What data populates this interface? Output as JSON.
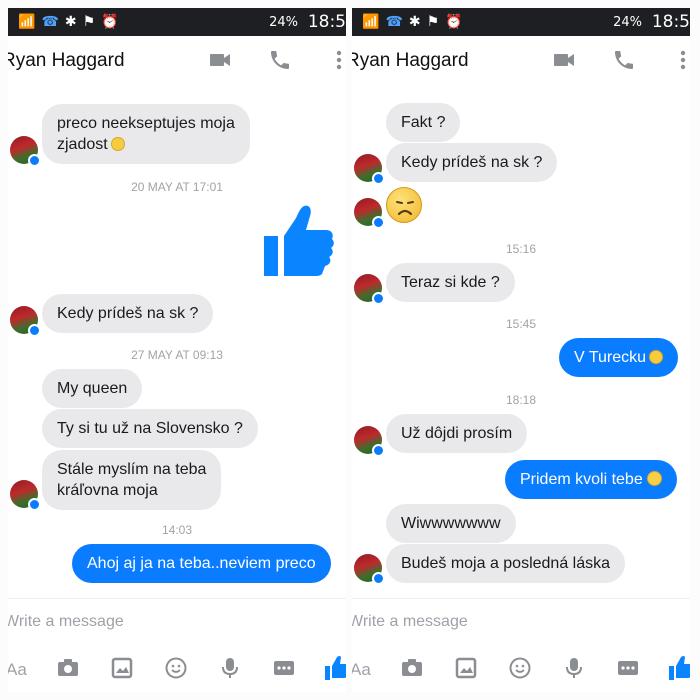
{
  "statusbar": {
    "battery": "24%",
    "time": "18:5"
  },
  "contact_name": "Ryan Haggard",
  "composer": {
    "placeholder": "Write a message",
    "aa": "Aa"
  },
  "left": {
    "messages": [
      {
        "from": "them",
        "text": "preco neekseptujes moja"
      },
      {
        "from": "them",
        "text": "zjadost"
      },
      {
        "timestamp": "20 MAY AT 17:01"
      },
      {
        "from": "me",
        "sticker": "thumbs-up"
      },
      {
        "from": "them",
        "text": "Kedy prídeš na sk ?"
      },
      {
        "timestamp": "27 MAY AT 09:13"
      },
      {
        "from": "them",
        "text": "My queen"
      },
      {
        "from": "them",
        "text": "Ty si tu už na Slovensko ?"
      },
      {
        "from": "them",
        "text": "Stále myslím na teba"
      },
      {
        "from": "them",
        "text": "kráľovna moja"
      },
      {
        "timestamp": "14:03"
      },
      {
        "from": "me",
        "text": "Ahoj aj ja na teba..neviem preco"
      }
    ]
  },
  "right": {
    "messages": [
      {
        "from": "them",
        "text": "Fakt ?"
      },
      {
        "from": "them",
        "text": "Kedy prídeš na sk ?"
      },
      {
        "from": "them",
        "emoji": "disappointed-face"
      },
      {
        "timestamp": "15:16"
      },
      {
        "from": "them",
        "text": "Teraz si kde ?"
      },
      {
        "timestamp": "15:45"
      },
      {
        "from": "me",
        "text": "V Turecku"
      },
      {
        "timestamp": "18:18"
      },
      {
        "from": "them",
        "text": "Už dôjdi prosím"
      },
      {
        "from": "me",
        "text": "Pridem kvoli tebe"
      },
      {
        "from": "them",
        "text": "Wiwwwwwww"
      },
      {
        "from": "them",
        "text": "Budeš moja a posledná láska"
      }
    ]
  },
  "colors": {
    "accent": "#0a7cff",
    "incoming_bubble": "#e9e9eb",
    "statusbar": "#1d1f22"
  },
  "icons": [
    "video-camera-icon",
    "phone-icon",
    "more-vertical-icon",
    "camera-icon",
    "image-icon",
    "emoji-icon",
    "microphone-icon",
    "more-horizontal-icon",
    "like-icon"
  ]
}
